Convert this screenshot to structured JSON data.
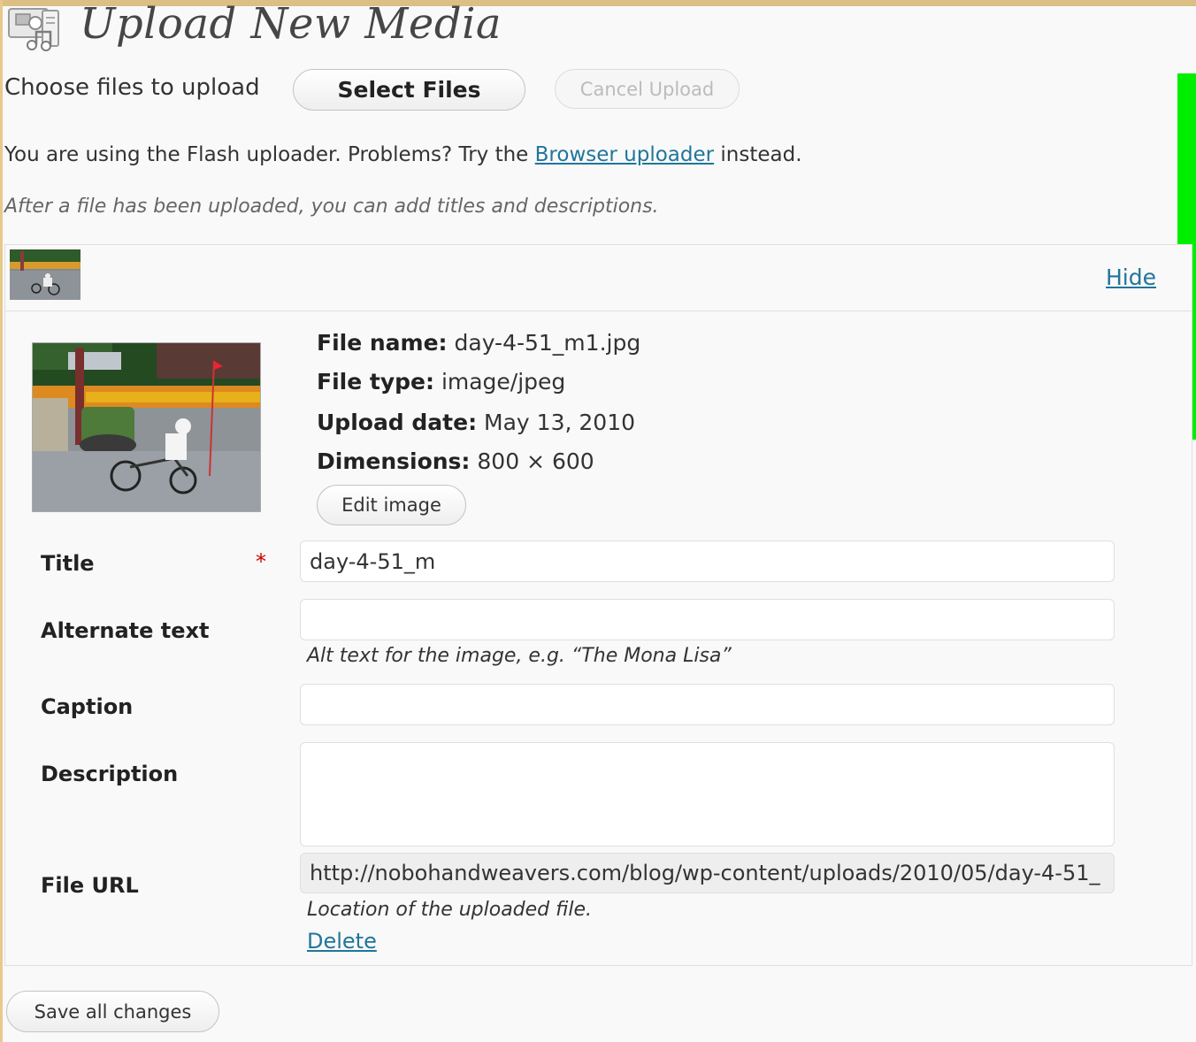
{
  "page": {
    "title": "Upload New Media",
    "icon": "media-library-icon"
  },
  "upload": {
    "choose_label": "Choose files to upload",
    "select_button": "Select Files",
    "cancel_button": "Cancel Upload",
    "flash_notice_before": "You are using the Flash uploader. Problems? Try the ",
    "flash_notice_link": "Browser uploader",
    "flash_notice_after": " instead.",
    "after_note": "After a file has been uploaded, you can add titles and descriptions."
  },
  "media_item": {
    "hide_link": "Hide",
    "file_name_label": "File name:",
    "file_name": "day-4-51_m1.jpg",
    "file_type_label": "File type:",
    "file_type": "image/jpeg",
    "upload_date_label": "Upload date:",
    "upload_date": "May 13, 2010",
    "dimensions_label": "Dimensions:",
    "dimensions": "800 × 600",
    "edit_image_button": "Edit image",
    "fields": {
      "title_label": "Title",
      "required_star": "*",
      "title_value": "day-4-51_m",
      "alt_label": "Alternate text",
      "alt_value": "",
      "alt_help": "Alt text for the image, e.g. “The Mona Lisa”",
      "caption_label": "Caption",
      "caption_value": "",
      "description_label": "Description",
      "description_value": "",
      "file_url_label": "File URL",
      "file_url_value": "http://nobohandweavers.com/blog/wp-content/uploads/2010/05/day-4-51_",
      "file_url_help": "Location of the uploaded file."
    },
    "delete_link": "Delete"
  },
  "footer": {
    "save_button": "Save all changes"
  },
  "colors": {
    "link": "#21759b",
    "required": "#cc0000",
    "top_border": "#dcbf84",
    "side_indicator": "#00ee00"
  }
}
